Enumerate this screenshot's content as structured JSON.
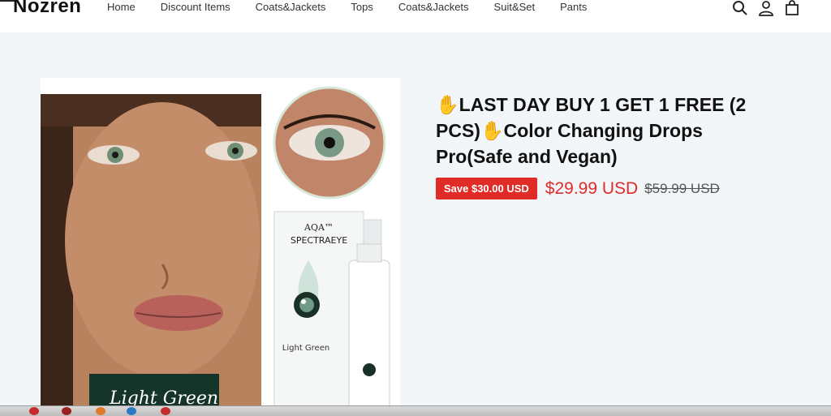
{
  "header": {
    "logo": "Nozren",
    "nav": [
      "Home",
      "Discount Items",
      "Coats&Jackets",
      "Tops",
      "Coats&Jackets",
      "Suit&Set",
      "Pants"
    ],
    "icons": [
      "search-icon",
      "account-icon",
      "cart-icon"
    ]
  },
  "product": {
    "image": {
      "brand": "AQA™",
      "line": "SPECTRAEYE",
      "shade": "Light Green",
      "caption": "Light Green"
    },
    "title_prefix": "✋",
    "title_part1": "LAST DAY BUY 1 GET 1 FREE (2 PCS)",
    "title_mid": "✋",
    "title_part2": "Color Changing Drops Pro(Safe and Vegan)",
    "badge": "Save $30.00 USD",
    "price": "$29.99 USD",
    "compare_price": "$59.99 USD"
  },
  "colors": {
    "accent": "#e02b27",
    "background": "#f3f6f9"
  }
}
